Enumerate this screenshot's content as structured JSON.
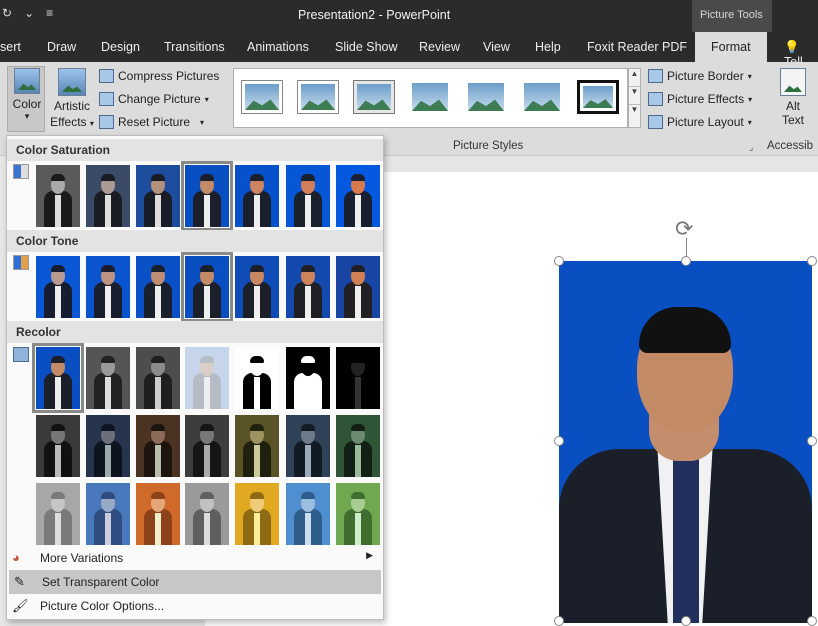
{
  "window": {
    "title": "Presentation2  -  PowerPoint",
    "context_tab": "Picture Tools",
    "qat_icons": [
      "autosave-icon",
      "chevron-down-icon",
      "customize-qat-icon"
    ]
  },
  "tabs": [
    {
      "label": "sert"
    },
    {
      "label": "Draw"
    },
    {
      "label": "Design"
    },
    {
      "label": "Transitions"
    },
    {
      "label": "Animations"
    },
    {
      "label": "Slide Show"
    },
    {
      "label": "Review"
    },
    {
      "label": "View"
    },
    {
      "label": "Help"
    },
    {
      "label": "Foxit Reader PDF"
    },
    {
      "label": "Format",
      "active": true
    }
  ],
  "tell_me": "Tell",
  "ribbon": {
    "color_btn": "Color",
    "color_arrow": "▾",
    "artistic_btn": "Artistic",
    "artistic_btn_2": "Effects",
    "compress": "Compress Pictures",
    "change": "Change Picture",
    "reset": "Reset Picture",
    "picture_border": "Picture Border",
    "picture_effects": "Picture Effects",
    "picture_layout": "Picture Layout",
    "alt_text": "Alt",
    "alt_text_2": "Text",
    "group_picture_styles": "Picture Styles",
    "group_accessibility": "Accessib"
  },
  "dropdown": {
    "color_saturation": "Color Saturation",
    "color_tone": "Color Tone",
    "recolor": "Recolor",
    "more_variations": "More Variations",
    "set_transparent": "Set Transparent Color",
    "picture_color_options": "Picture Color Options...",
    "selected_saturation_index": 3,
    "selected_tone_index": 3,
    "selected_recolor_index": 0
  },
  "colors": {
    "photo_bg": "#0a4fc2",
    "ribbon_bg": "#dcdcdc",
    "titlebar_bg": "#2b2b2b"
  }
}
